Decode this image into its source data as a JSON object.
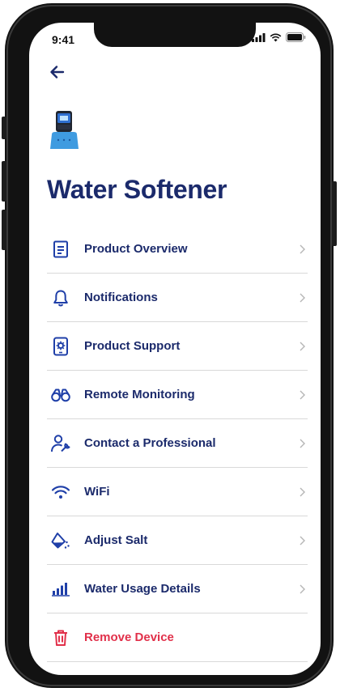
{
  "status": {
    "time": "9:41"
  },
  "header": {
    "title": "Water Softener"
  },
  "menu": {
    "items": [
      {
        "label": "Product Overview",
        "icon": "document-icon"
      },
      {
        "label": "Notifications",
        "icon": "bell-icon"
      },
      {
        "label": "Product Support",
        "icon": "gear-phone-icon"
      },
      {
        "label": "Remote Monitoring",
        "icon": "binoculars-icon"
      },
      {
        "label": "Contact a Professional",
        "icon": "plumber-icon"
      },
      {
        "label": "WiFi",
        "icon": "wifi-icon"
      },
      {
        "label": "Adjust Salt",
        "icon": "salt-pour-icon"
      },
      {
        "label": "Water Usage Details",
        "icon": "bar-chart-icon"
      },
      {
        "label": "Remove Device",
        "icon": "trash-icon"
      }
    ]
  },
  "colors": {
    "primary": "#1b2a6b",
    "icon_blue": "#1f3fa8",
    "danger": "#e1304a",
    "divider": "#d9d9d9",
    "chevron": "#b5b5b5"
  }
}
